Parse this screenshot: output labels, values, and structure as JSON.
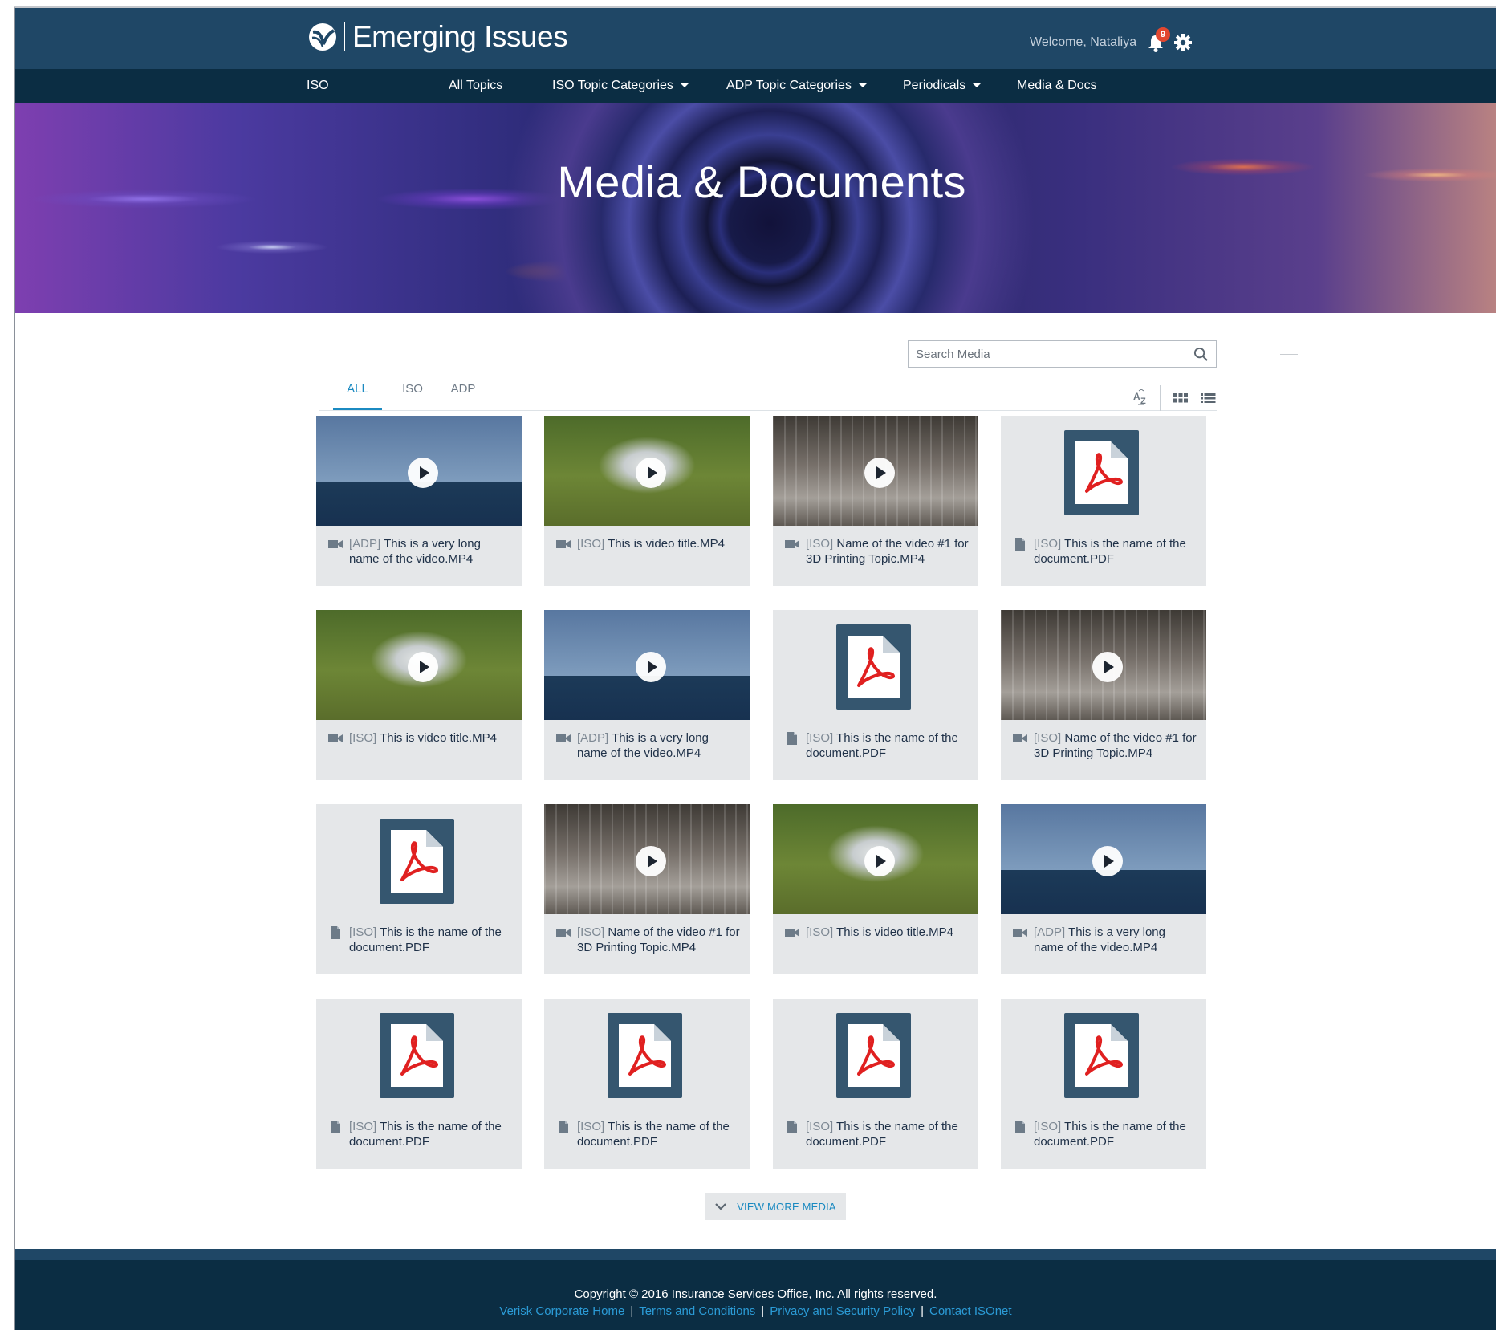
{
  "header": {
    "logo_text": "Emerging Issues",
    "welcome": "Welcome, Nataliya",
    "notification_count": "9"
  },
  "nav": {
    "brand": "ISO",
    "items": [
      {
        "label": "All Topics",
        "dropdown": false
      },
      {
        "label": "ISO Topic Categories",
        "dropdown": true
      },
      {
        "label": "ADP Topic Categories",
        "dropdown": true
      },
      {
        "label": "Periodicals",
        "dropdown": true
      },
      {
        "label": "Media & Docs",
        "dropdown": false
      }
    ]
  },
  "hero": {
    "title": "Media & Documents"
  },
  "search": {
    "placeholder": "Search Media"
  },
  "tabs": [
    "ALL",
    "ISO",
    "ADP"
  ],
  "cards": [
    {
      "type": "video",
      "thumb": "oil-rig",
      "source": "[ADP]",
      "name": "This is a very long name of the video.MP4"
    },
    {
      "type": "video",
      "thumb": "drone",
      "source": "[ISO]",
      "name": "This is video title.MP4"
    },
    {
      "type": "video",
      "thumb": "3d-printer",
      "source": "[ISO]",
      "name": "Name of the video #1 for 3D Printing Topic.MP4"
    },
    {
      "type": "pdf",
      "thumb": "pdf",
      "source": "[ISO]",
      "name": "This is the name of the document.PDF"
    },
    {
      "type": "video",
      "thumb": "drone",
      "source": "[ISO]",
      "name": "This is video title.MP4"
    },
    {
      "type": "video",
      "thumb": "oil-rig",
      "source": "[ADP]",
      "name": "This is a very long name of the video.MP4"
    },
    {
      "type": "pdf",
      "thumb": "pdf",
      "source": "[ISO]",
      "name": "This is the name of the document.PDF"
    },
    {
      "type": "video",
      "thumb": "3d-printer",
      "source": "[ISO]",
      "name": "Name of the video #1 for 3D Printing Topic.MP4"
    },
    {
      "type": "pdf",
      "thumb": "pdf",
      "source": "[ISO]",
      "name": "This is the name of the document.PDF"
    },
    {
      "type": "video",
      "thumb": "3d-printer",
      "source": "[ISO]",
      "name": "Name of the video #1 for 3D Printing Topic.MP4"
    },
    {
      "type": "video",
      "thumb": "drone",
      "source": "[ISO]",
      "name": "This is video title.MP4"
    },
    {
      "type": "video",
      "thumb": "oil-rig",
      "source": "[ADP]",
      "name": "This is a very long name of the video.MP4"
    },
    {
      "type": "pdf",
      "thumb": "pdf",
      "source": "[ISO]",
      "name": "This is the name of the document.PDF"
    },
    {
      "type": "pdf",
      "thumb": "pdf",
      "source": "[ISO]",
      "name": "This is the name of the document.PDF"
    },
    {
      "type": "pdf",
      "thumb": "pdf",
      "source": "[ISO]",
      "name": "This is the name of the document.PDF"
    },
    {
      "type": "pdf",
      "thumb": "pdf",
      "source": "[ISO]",
      "name": "This is the name of the document.PDF"
    }
  ],
  "view_more": "VIEW MORE MEDIA",
  "footer": {
    "copyright": "Copyright © 2016 Insurance Services Office, Inc. All rights reserved.",
    "links": [
      "Verisk Corporate Home",
      "Terms and Conditions",
      "Privacy and Security Policy",
      "Contact ISOnet"
    ]
  },
  "colors": {
    "header_bg": "#1f4766",
    "nav_bg": "#0b2d43",
    "accent": "#1b8ac1",
    "card_bg": "#e5e7e9",
    "badge": "#e2472f"
  }
}
